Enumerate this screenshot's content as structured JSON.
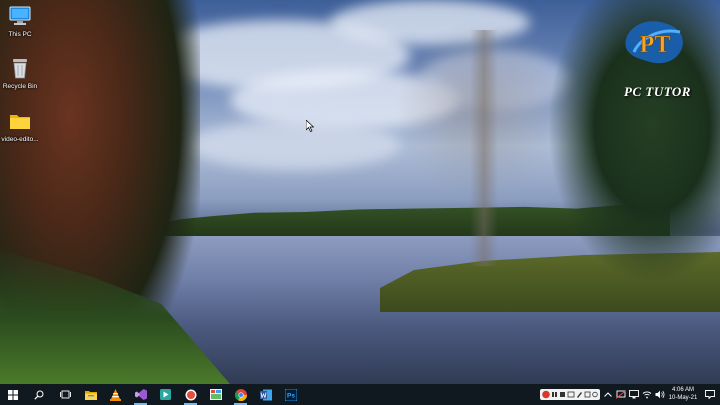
{
  "desktop": {
    "icons": [
      {
        "label": "This PC",
        "icon": "this-pc-icon"
      },
      {
        "label": "Recycle Bin",
        "icon": "recycle-bin-icon"
      },
      {
        "label": "video-edito...",
        "icon": "folder-icon"
      }
    ],
    "logo": {
      "monogram": "PT",
      "brand": "PC TUTOR"
    }
  },
  "taskbar": {
    "left": [
      {
        "icon": "windows-start-icon"
      },
      {
        "icon": "search-icon"
      },
      {
        "icon": "task-view-icon"
      }
    ],
    "apps": [
      {
        "icon": "file-explorer-icon",
        "color": "#f2c94c"
      },
      {
        "icon": "vlc-icon",
        "color": "#f28c00"
      },
      {
        "icon": "visual-studio-icon",
        "color": "#9b59d0"
      },
      {
        "icon": "media-player-icon",
        "color": "#2aa7a0"
      },
      {
        "icon": "screen-recorder-icon",
        "color": "#e74c3c"
      },
      {
        "icon": "paint-icon",
        "color": "#e8e8e8"
      },
      {
        "icon": "chrome-icon",
        "color": "#4285f4"
      },
      {
        "icon": "word-icon",
        "color": "#2b579a"
      },
      {
        "icon": "photoshop-icon",
        "color": "#31a8ff"
      }
    ],
    "tray": {
      "icons": [
        "recorder-toolbar-icon",
        "chevron-up-icon",
        "usb-icon",
        "display-icon",
        "network-icon",
        "volume-icon"
      ],
      "time": "4:06 AM",
      "date": "10-May-21"
    },
    "colors": {
      "bar": "#101820",
      "accent": "#76b9ed"
    }
  }
}
